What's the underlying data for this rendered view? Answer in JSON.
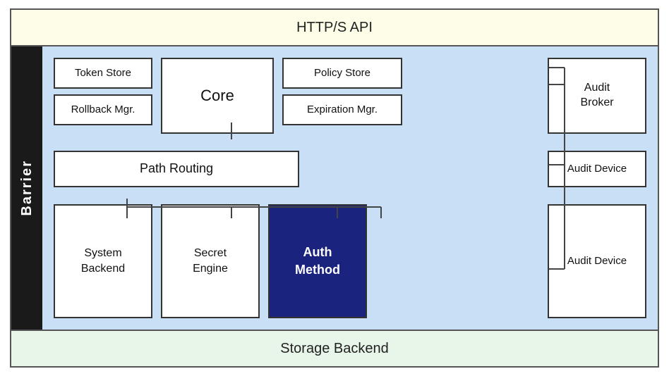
{
  "http_bar": {
    "label": "HTTP/S API"
  },
  "barrier": {
    "label": "Barrier"
  },
  "storage_bar": {
    "label": "Storage Backend"
  },
  "boxes": {
    "token_store": "Token Store",
    "rollback_mgr": "Rollback Mgr.",
    "core": "Core",
    "policy_store": "Policy Store",
    "expiration_mgr": "Expiration Mgr.",
    "audit_broker": "Audit\nBroker",
    "path_routing": "Path Routing",
    "audit_device_1": "Audit Device",
    "system_backend": "System\nBackend",
    "secret_engine": "Secret\nEngine",
    "auth_method": "Auth\nMethod",
    "audit_device_2": "Audit Device"
  },
  "colors": {
    "http_bg": "#fefde8",
    "storage_bg": "#e8f5e9",
    "main_bg": "#c8dff5",
    "barrier_bg": "#1a1a1a",
    "auth_bg": "#1a237e",
    "box_bg": "#ffffff",
    "border": "#333333"
  }
}
